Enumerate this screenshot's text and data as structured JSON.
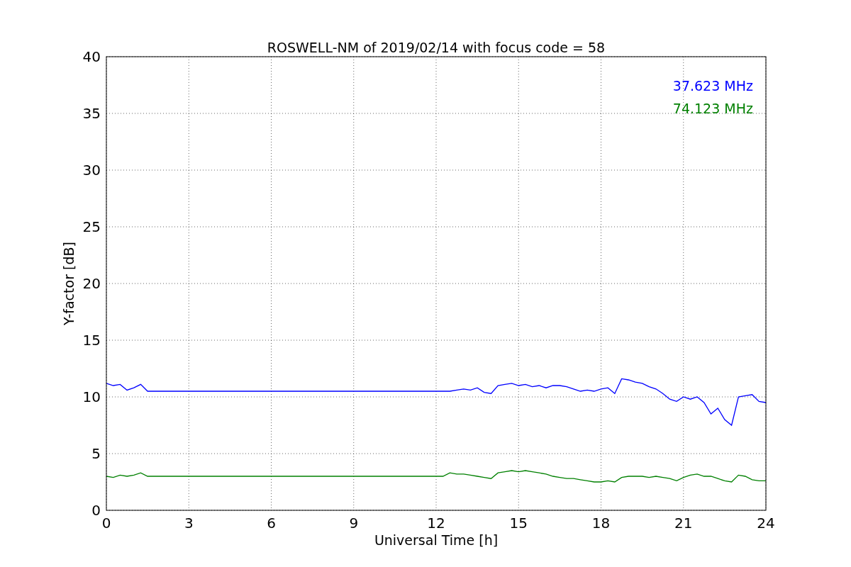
{
  "chart_data": {
    "type": "line",
    "title": "ROSWELL-NM of 2019/02/14 with focus code = 58",
    "xlabel": "Universal Time [h]",
    "ylabel": "Y-factor [dB]",
    "x": [
      0,
      0.25,
      0.5,
      0.75,
      1,
      1.25,
      1.5,
      12.25,
      12.5,
      12.75,
      13,
      13.25,
      13.5,
      13.75,
      14,
      14.25,
      14.5,
      14.75,
      15,
      15.25,
      15.5,
      15.75,
      16,
      16.25,
      16.5,
      16.75,
      17,
      17.25,
      17.5,
      17.75,
      18,
      18.25,
      18.5,
      18.75,
      19,
      19.25,
      19.5,
      19.75,
      20,
      20.25,
      20.5,
      20.75,
      21,
      21.25,
      21.5,
      21.75,
      22,
      22.25,
      22.5,
      22.75,
      23,
      23.25,
      23.5,
      23.75,
      24
    ],
    "series": [
      {
        "name": "37.623 MHz",
        "color": "#0000ff",
        "values": [
          11.2,
          11.0,
          11.1,
          10.6,
          10.8,
          11.1,
          10.5,
          10.5,
          10.5,
          10.6,
          10.7,
          10.6,
          10.8,
          10.4,
          10.3,
          11.0,
          11.1,
          11.2,
          11.0,
          11.1,
          10.9,
          11.0,
          10.8,
          11.0,
          11.0,
          10.9,
          10.7,
          10.5,
          10.6,
          10.5,
          10.7,
          10.8,
          10.3,
          11.6,
          11.5,
          11.3,
          11.2,
          10.9,
          10.7,
          10.3,
          9.8,
          9.6,
          10.0,
          9.8,
          10.0,
          9.5,
          8.5,
          9.0,
          8.0,
          7.5,
          10.0,
          10.1,
          10.2,
          9.6,
          9.5
        ]
      },
      {
        "name": "74.123 MHz",
        "color": "#008000",
        "values": [
          3.0,
          2.9,
          3.1,
          3.0,
          3.1,
          3.3,
          3.0,
          3.0,
          3.3,
          3.2,
          3.2,
          3.1,
          3.0,
          2.9,
          2.8,
          3.3,
          3.4,
          3.5,
          3.4,
          3.5,
          3.4,
          3.3,
          3.2,
          3.0,
          2.9,
          2.8,
          2.8,
          2.7,
          2.6,
          2.5,
          2.5,
          2.6,
          2.5,
          2.9,
          3.0,
          3.0,
          3.0,
          2.9,
          3.0,
          2.9,
          2.8,
          2.6,
          2.9,
          3.1,
          3.2,
          3.0,
          3.0,
          2.8,
          2.6,
          2.5,
          3.1,
          3.0,
          2.7,
          2.6,
          2.6
        ]
      }
    ],
    "grid": true,
    "xlim": [
      0,
      24
    ],
    "ylim": [
      0,
      40
    ],
    "xticks": [
      0,
      3,
      6,
      9,
      12,
      15,
      18,
      21,
      24
    ],
    "yticks": [
      0,
      5,
      10,
      15,
      20,
      25,
      30,
      35,
      40
    ]
  }
}
